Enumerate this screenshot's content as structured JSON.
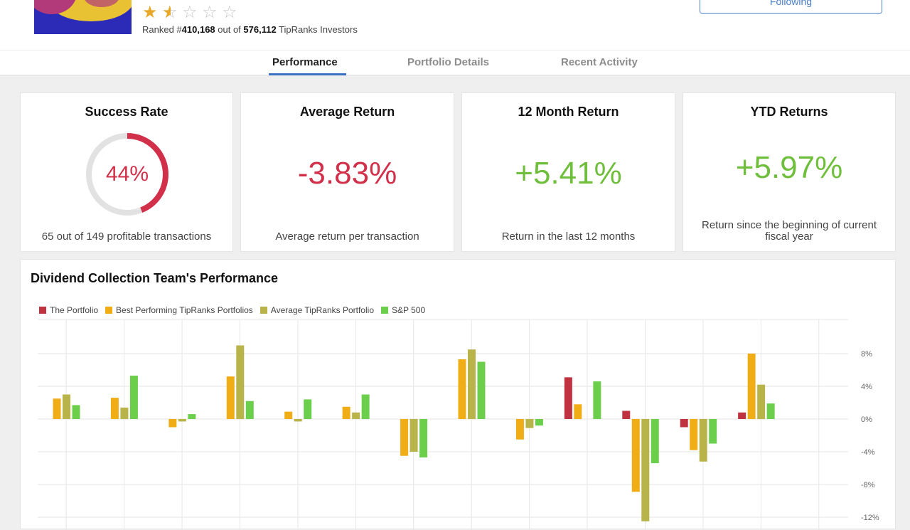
{
  "header": {
    "rating_stars": 1.5,
    "ranked_prefix": "Ranked #",
    "rank": "410,168",
    "ranked_mid": " out of ",
    "total": "576,112",
    "ranked_suffix": " TipRanks Investors",
    "follow_button": "Following"
  },
  "tabs": [
    {
      "label": "Performance",
      "active": true
    },
    {
      "label": "Portfolio Details",
      "active": false
    },
    {
      "label": "Recent Activity",
      "active": false
    }
  ],
  "cards": {
    "success": {
      "title": "Success Rate",
      "value": "44%",
      "desc": "65 out of 149 profitable transactions",
      "rate": 0.44
    },
    "average": {
      "title": "Average Return",
      "value": "-3.83%",
      "desc": "Average return per transaction"
    },
    "twelve": {
      "title": "12 Month Return",
      "value": "+5.41%",
      "desc": "Return in the last 12 months"
    },
    "ytd": {
      "title": "YTD Returns",
      "value": "+5.97%",
      "desc": "Return since the beginning of current fiscal year"
    }
  },
  "colors": {
    "negative": "#d2304a",
    "positive": "#6fbf3c",
    "accent": "#3a70c2"
  },
  "chart_data": {
    "type": "bar",
    "title": "Dividend Collection Team's Performance",
    "ylim": [
      -12,
      12
    ],
    "ytick_labels": [
      "8%",
      "4%",
      "0%",
      "-4%",
      "-8%",
      "-12%"
    ],
    "ytick_values": [
      8,
      4,
      0,
      -4,
      -8,
      -12
    ],
    "grid": true,
    "legend_position": "top-left",
    "categories": [
      "",
      "",
      "",
      "",
      "",
      "",
      "",
      "",
      "",
      "",
      "",
      "",
      "",
      ""
    ],
    "series": [
      {
        "name": "The Portfolio",
        "color": "#c0323f",
        "values": [
          null,
          null,
          null,
          null,
          null,
          null,
          null,
          null,
          null,
          5.1,
          1.0,
          -1.0,
          0.8,
          null
        ]
      },
      {
        "name": "Best Performing TipRanks Portfolios",
        "color": "#f0ad16",
        "values": [
          2.5,
          2.6,
          -1.0,
          5.2,
          0.9,
          1.5,
          -4.5,
          7.3,
          -2.5,
          1.8,
          -8.9,
          -3.8,
          8.0,
          null
        ]
      },
      {
        "name": "Average TipRanks Portfolio",
        "color": "#b8b44a",
        "values": [
          3.0,
          1.4,
          -0.3,
          9.0,
          -0.3,
          0.8,
          -4.0,
          8.5,
          -1.1,
          null,
          -12.5,
          -5.2,
          4.2,
          null
        ]
      },
      {
        "name": "S&P 500",
        "color": "#6ccf4c",
        "values": [
          1.7,
          5.3,
          0.6,
          2.2,
          2.4,
          3.0,
          -4.7,
          7.0,
          -0.8,
          4.6,
          -5.4,
          -3.0,
          1.9,
          null
        ]
      }
    ]
  }
}
